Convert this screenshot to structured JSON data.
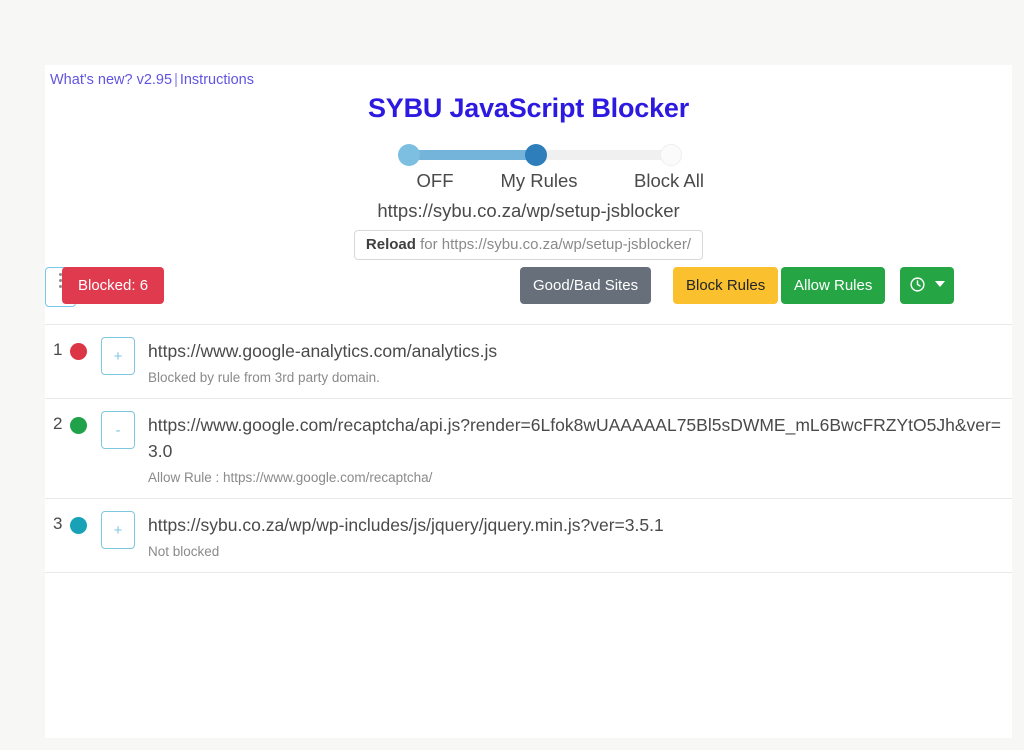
{
  "header": {
    "whats_new": "What's new? v2.95",
    "separator": "|",
    "instructions": "Instructions",
    "title": "SYBU JavaScript Blocker"
  },
  "mode_slider": {
    "labels": [
      "OFF",
      "My Rules",
      "Block All"
    ],
    "selected": "My Rules",
    "selected_index": 1,
    "colors": {
      "off_knob": "#7cbfe0",
      "selected_knob": "#2e7ebb",
      "fill": "#74b4da",
      "track": "#f0f0f0"
    }
  },
  "page": {
    "url": "https://sybu.co.za/wp/setup-jsblocker",
    "reload_label": "Reload",
    "reload_suffix": "for https://sybu.co.za/wp/setup-jsblocker/"
  },
  "toolbar": {
    "blocked_badge": "Blocked: 6",
    "good_bad_sites": "Good/Bad Sites",
    "block_rules": "Block Rules",
    "allow_rules": "Allow Rules",
    "clock_icon": "clock-icon",
    "caret_icon": "chevron-down-icon",
    "kebab_icon": "more-vertical-icon",
    "colors": {
      "blocked": "#e03a4e",
      "good_bad": "#67707a",
      "block_rules": "#fbc02d",
      "allow_rules": "#26a545",
      "clock": "#26a545",
      "kebab_border": "#79c8e8"
    }
  },
  "script_list": [
    {
      "index": "1",
      "status_color": "red",
      "action_label": "+",
      "url": "https://www.google-analytics.com/analytics.js",
      "note": "Blocked by rule from 3rd party domain."
    },
    {
      "index": "2",
      "status_color": "green",
      "action_label": "-",
      "url": "https://www.google.com/recaptcha/api.js?render=6Lfok8wUAAAAAL75Bl5sDWME_mL6BwcFRZYtO5Jh&ver=3.0",
      "note": "Allow Rule : https://www.google.com/recaptcha/"
    },
    {
      "index": "3",
      "status_color": "cyan",
      "action_label": "+",
      "url": "https://sybu.co.za/wp/wp-includes/js/jquery/jquery.min.js?ver=3.5.1",
      "note": "Not blocked"
    }
  ]
}
